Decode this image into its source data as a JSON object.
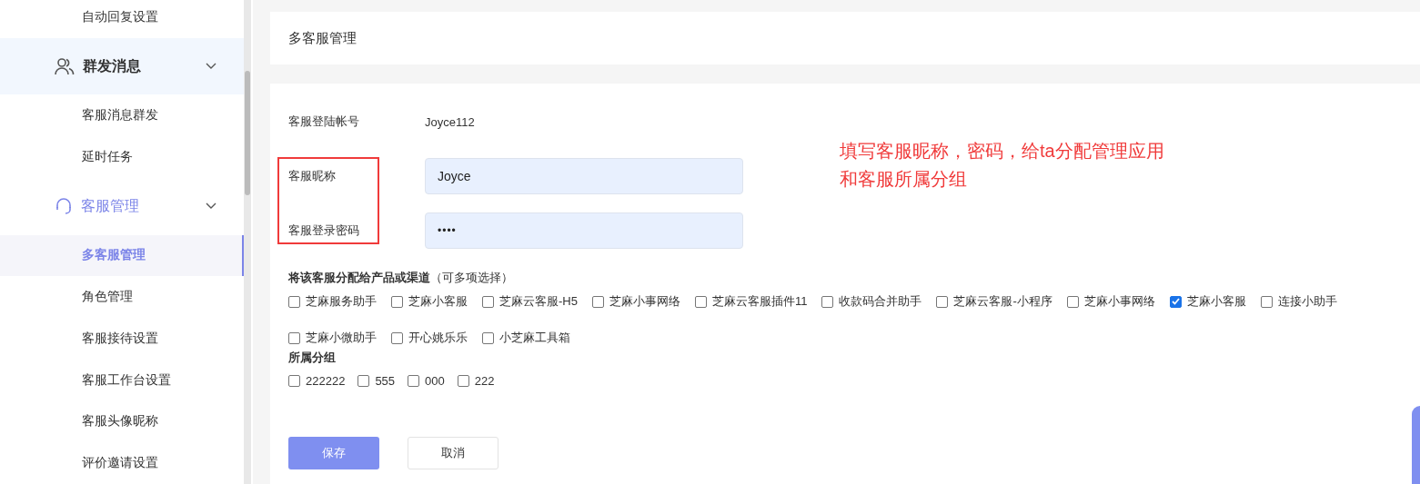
{
  "sidebar": {
    "items": [
      {
        "kind": "sub",
        "label": "自动回复设置",
        "selected": false
      },
      {
        "kind": "group",
        "label": "群发消息",
        "expanded": true,
        "selected": false,
        "hovered": true
      },
      {
        "kind": "sub",
        "label": "客服消息群发",
        "selected": false
      },
      {
        "kind": "sub",
        "label": "延时任务",
        "selected": false
      },
      {
        "kind": "group",
        "label": "客服管理",
        "expanded": true,
        "selected": true,
        "hovered": false
      },
      {
        "kind": "sub",
        "label": "多客服管理",
        "selected": true
      },
      {
        "kind": "sub",
        "label": "角色管理",
        "selected": false
      },
      {
        "kind": "sub",
        "label": "客服接待设置",
        "selected": false
      },
      {
        "kind": "sub",
        "label": "客服工作台设置",
        "selected": false
      },
      {
        "kind": "sub",
        "label": "客服头像昵称",
        "selected": false
      },
      {
        "kind": "sub",
        "label": "评价邀请设置",
        "selected": false
      }
    ]
  },
  "header": {
    "title": "多客服管理"
  },
  "form": {
    "account": {
      "label": "客服登陆帐号",
      "value": "Joyce112"
    },
    "fields": [
      {
        "label": "客服昵称",
        "kind": "text",
        "value": "Joyce"
      },
      {
        "label": "客服登录密码",
        "kind": "password",
        "value": "••••"
      }
    ],
    "products": {
      "title": "**将该客服分配给产品或渠道**（可多项选择）",
      "options": [
        {
          "label": "芝麻服务助手",
          "checked": false
        },
        {
          "label": "芝麻小客服",
          "checked": false
        },
        {
          "label": "芝麻云客服-H5",
          "checked": false
        },
        {
          "label": "芝麻小事网络",
          "checked": false
        },
        {
          "label": "芝麻云客服插件11",
          "checked": false
        },
        {
          "label": "收款码合并助手",
          "checked": false
        },
        {
          "label": "芝麻云客服-小程序",
          "checked": false
        },
        {
          "label": "芝麻小事网络",
          "checked": false
        },
        {
          "label": "芝麻小客服",
          "checked": true
        },
        {
          "label": "连接小助手",
          "checked": false
        },
        {
          "label": "芝麻小微助手",
          "checked": false
        },
        {
          "label": "开心姚乐乐",
          "checked": false
        },
        {
          "label": "小芝麻工具箱",
          "checked": false
        }
      ]
    },
    "groups": {
      "title": "所属分组",
      "options": [
        {
          "label": "222222",
          "checked": false
        },
        {
          "label": "555",
          "checked": false
        },
        {
          "label": "000",
          "checked": false
        },
        {
          "label": "222",
          "checked": false
        }
      ]
    },
    "buttons": [
      {
        "label": "保存",
        "kind": "primary"
      },
      {
        "label": "取消",
        "kind": "default"
      }
    ]
  },
  "annotation": {
    "lines": [
      "填写客服昵称，密码，给ta分配管理应用",
      "和客服所属分组"
    ]
  }
}
